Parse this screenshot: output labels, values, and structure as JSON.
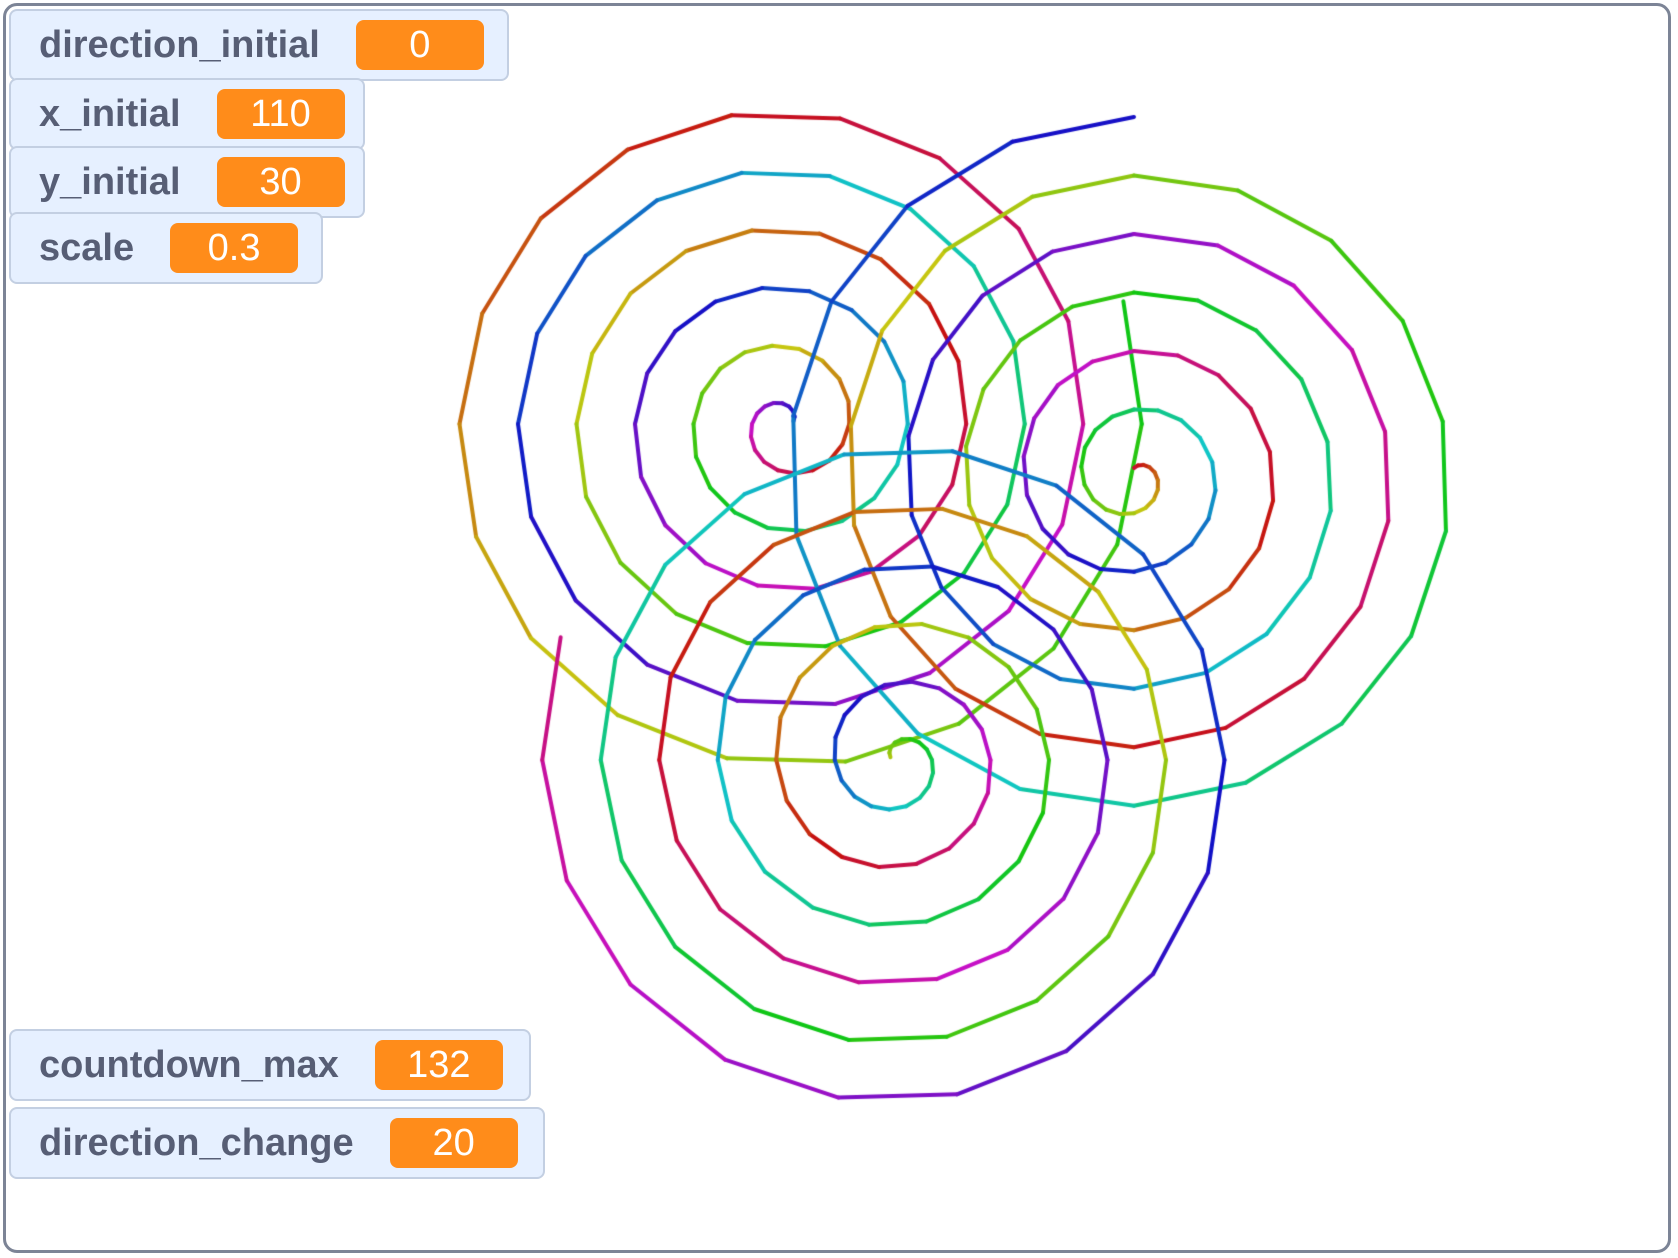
{
  "stage": {
    "border_color": "#7c8496",
    "background": "#ffffff"
  },
  "monitors": {
    "direction_initial": {
      "label": "direction_initial",
      "value": "0"
    },
    "x_initial": {
      "label": "x_initial",
      "value": "110"
    },
    "y_initial": {
      "label": "y_initial",
      "value": "30"
    },
    "scale": {
      "label": "scale",
      "value": "0.3"
    },
    "countdown_max": {
      "label": "countdown_max",
      "value": "132"
    },
    "direction_change": {
      "label": "direction_change",
      "value": "20"
    }
  },
  "colors": {
    "monitor_bg": "#e6f0ff",
    "value_bg": "#ff8c1a",
    "label_text": "#575e75"
  },
  "drawing": {
    "description_icon": "pen-spiral-drawing",
    "spiral_count": 3,
    "line_style": "rainbow hue gradient"
  }
}
